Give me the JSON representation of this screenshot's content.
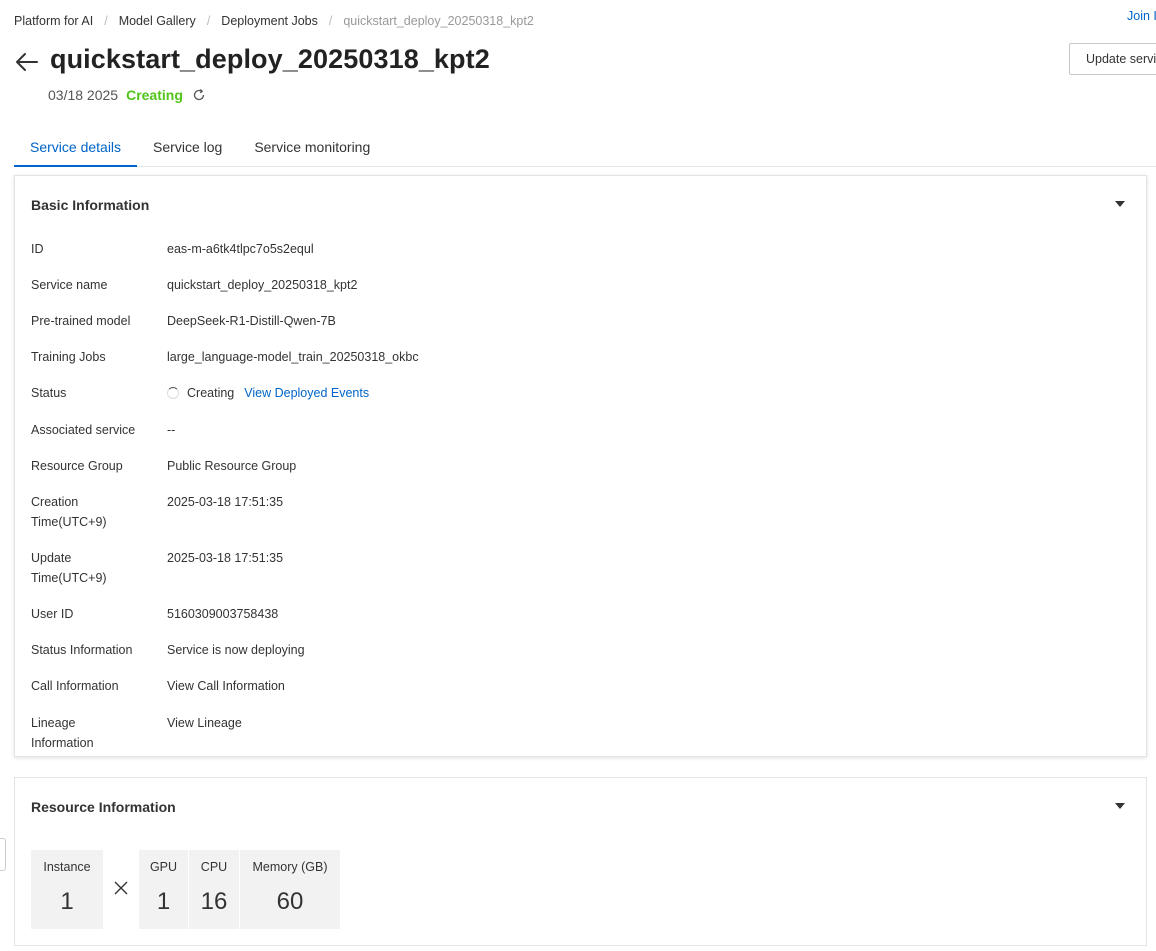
{
  "breadcrumb": {
    "items": [
      "Platform for AI",
      "Model Gallery",
      "Deployment Jobs"
    ],
    "current": "quickstart_deploy_20250318_kpt2",
    "separator": "/"
  },
  "join_link": "Join I",
  "header": {
    "title": "quickstart_deploy_20250318_kpt2",
    "date": "03/18 2025",
    "status": "Creating",
    "update_button": "Update service"
  },
  "tabs": [
    {
      "label": "Service details",
      "active": true
    },
    {
      "label": "Service log",
      "active": false
    },
    {
      "label": "Service monitoring",
      "active": false
    }
  ],
  "basic_info": {
    "title": "Basic Information",
    "rows": {
      "id": {
        "label": "ID",
        "value": "eas-m-a6tk4tlpc7o5s2equl"
      },
      "service_name": {
        "label": "Service name",
        "value": "quickstart_deploy_20250318_kpt2"
      },
      "pretrained_model": {
        "label": "Pre-trained model",
        "value": "DeepSeek-R1-Distill-Qwen-7B"
      },
      "training_jobs": {
        "label": "Training Jobs",
        "value": "large_language-model_train_20250318_okbc"
      },
      "status": {
        "label": "Status",
        "value": "Creating",
        "link": "View Deployed Events"
      },
      "associated_service": {
        "label": "Associated service",
        "value": "--"
      },
      "resource_group": {
        "label": "Resource Group",
        "value": "Public Resource Group"
      },
      "creation_time": {
        "label": "Creation Time(UTC+9)",
        "value": "2025-03-18 17:51:35"
      },
      "update_time": {
        "label": "Update Time(UTC+9)",
        "value": "2025-03-18 17:51:35"
      },
      "user_id": {
        "label": "User ID",
        "value": "5160309003758438"
      },
      "status_information": {
        "label": "Status Information",
        "value": "Service is now deploying"
      },
      "call_information": {
        "label": "Call Information",
        "value": "View Call Information"
      },
      "lineage_information": {
        "label": "Lineage Information",
        "value": "View Lineage"
      }
    }
  },
  "resource_info": {
    "title": "Resource Information",
    "instance": {
      "label": "Instance",
      "value": "1"
    },
    "multiplier": "×",
    "gpu": {
      "label": "GPU",
      "value": "1"
    },
    "cpu": {
      "label": "CPU",
      "value": "16"
    },
    "memory": {
      "label": "Memory (GB)",
      "value": "60"
    }
  },
  "colors": {
    "link": "#0064c8",
    "status_green": "#52c41a",
    "resource_bg": "#f2f2f2"
  },
  "icons": [
    "arrow-left-icon",
    "refresh-icon",
    "caret-down-icon",
    "spinner-icon",
    "close-multiply-icon"
  ]
}
